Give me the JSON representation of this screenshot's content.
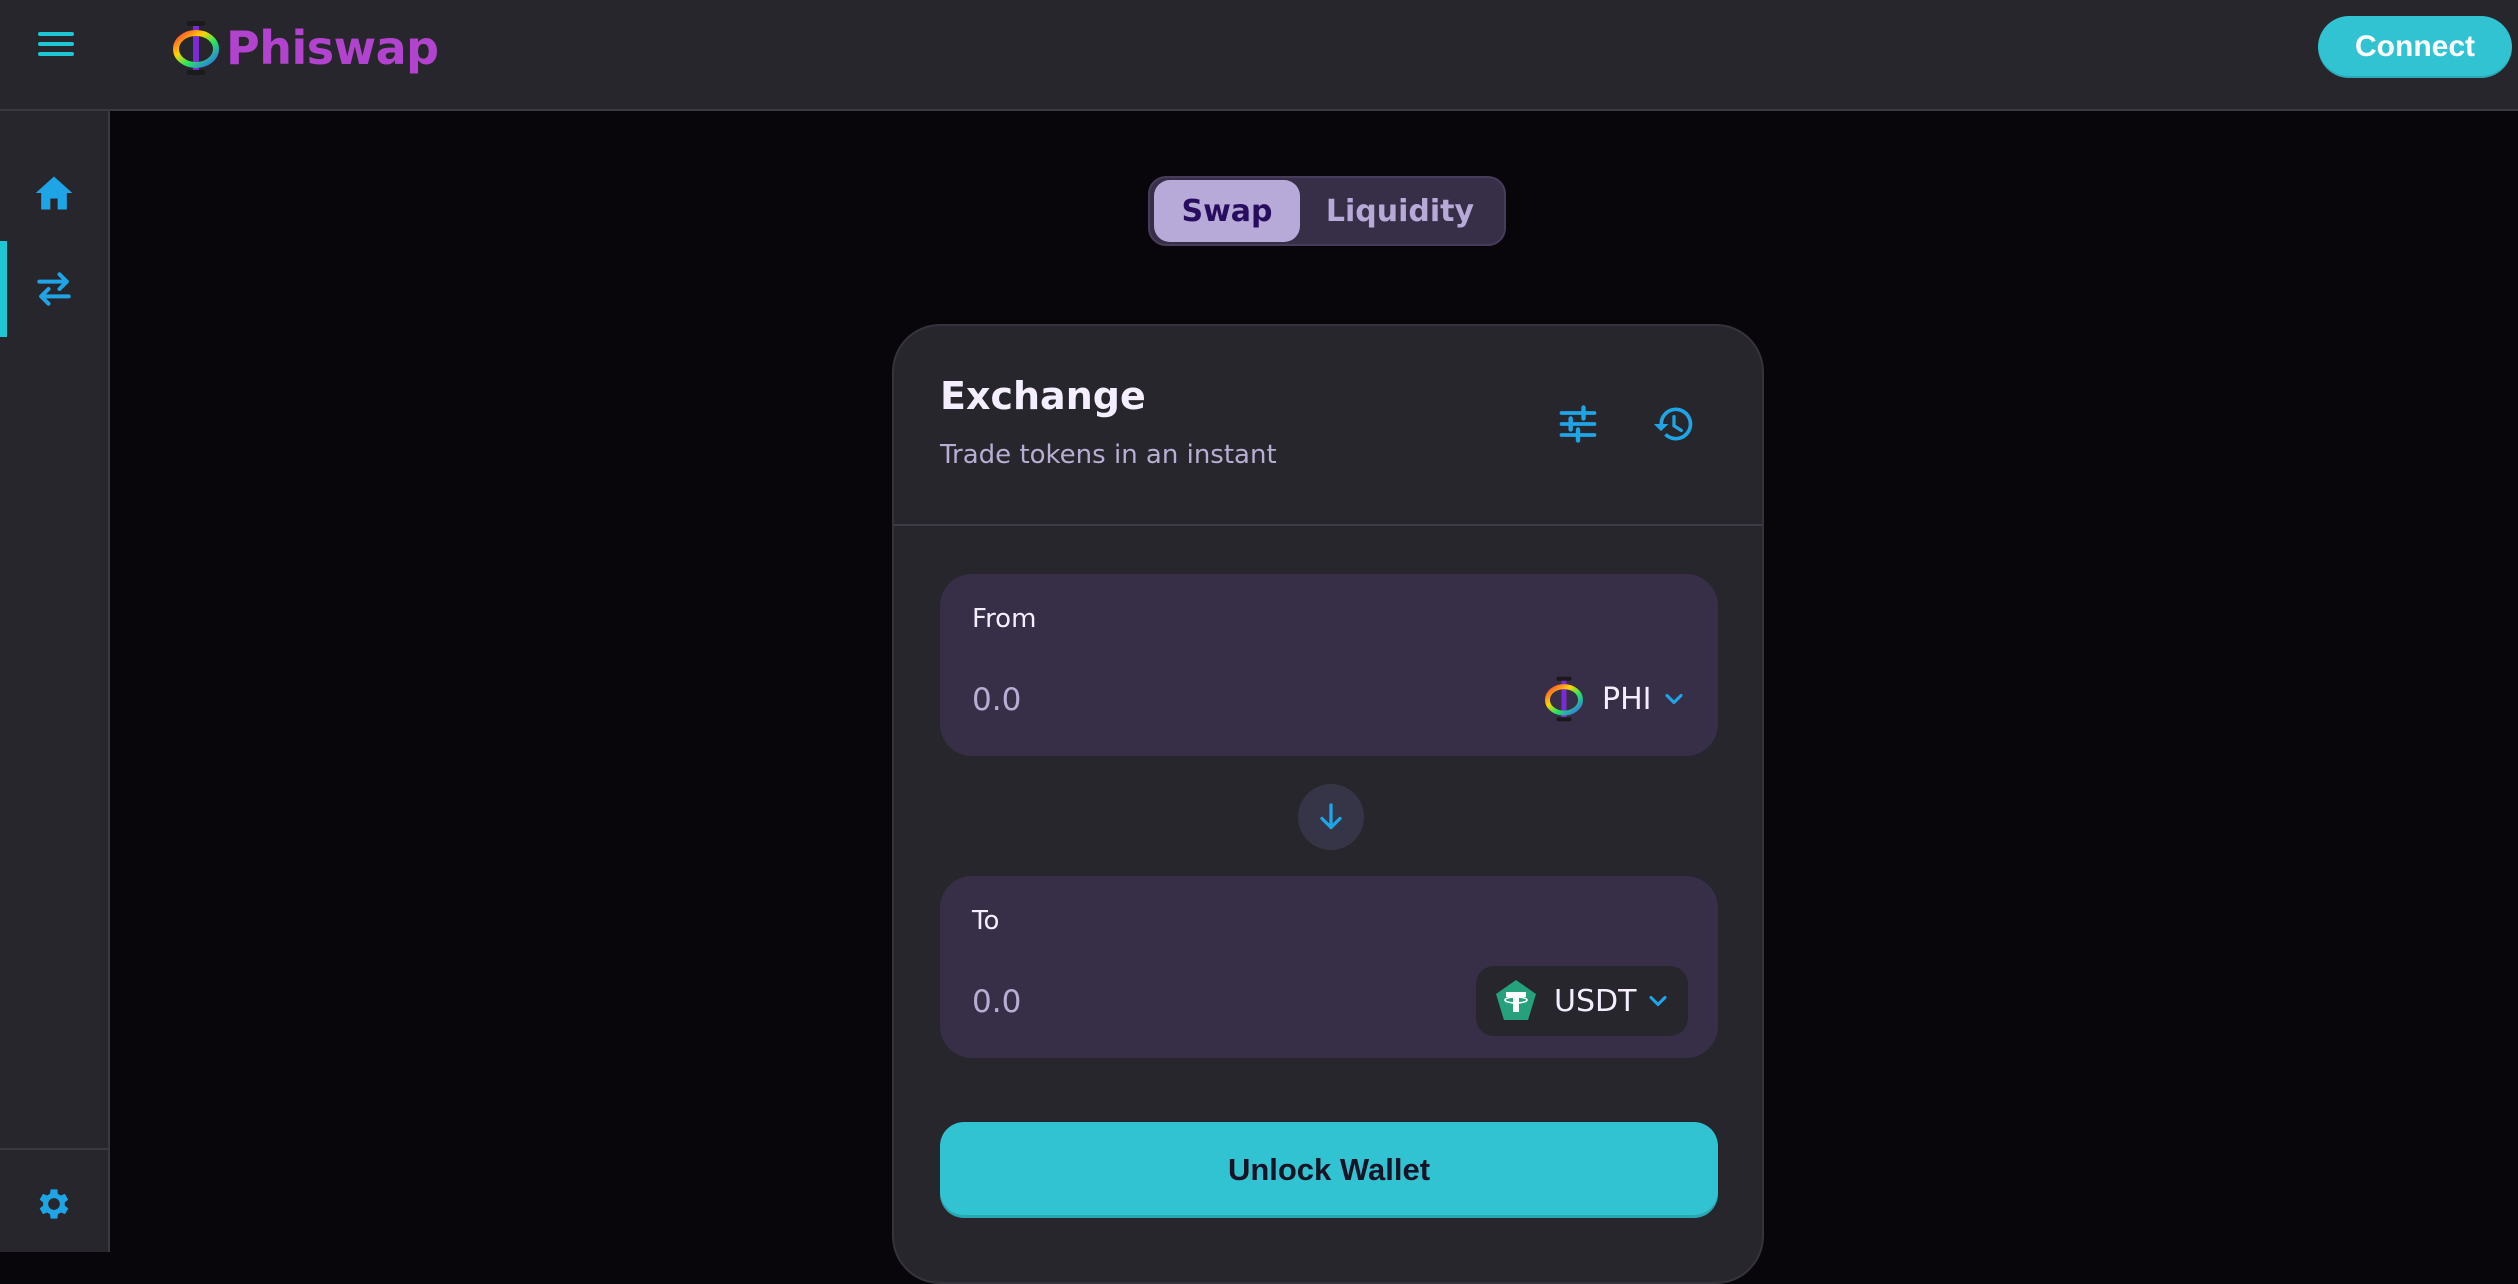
{
  "header": {
    "brand": "Phiswap",
    "connect_label": "Connect"
  },
  "sidebar": {
    "items": [
      {
        "name": "home",
        "icon": "home-icon"
      },
      {
        "name": "trade",
        "icon": "swap-arrows-icon",
        "active": true
      }
    ],
    "settings_icon": "gear-icon"
  },
  "tabs": [
    {
      "label": "Swap",
      "active": true
    },
    {
      "label": "Liquidity",
      "active": false
    }
  ],
  "exchange": {
    "title": "Exchange",
    "subtitle": "Trade tokens in an instant",
    "from": {
      "label": "From",
      "placeholder": "0.0",
      "token": "PHI"
    },
    "to": {
      "label": "To",
      "placeholder": "0.0",
      "token": "USDT"
    },
    "unlock_label": "Unlock Wallet"
  },
  "colors": {
    "accent": "#31c3d2",
    "brand": "#b143ce",
    "panel": "#27262c",
    "field": "#372f47",
    "icon": "#1fa5e6"
  }
}
